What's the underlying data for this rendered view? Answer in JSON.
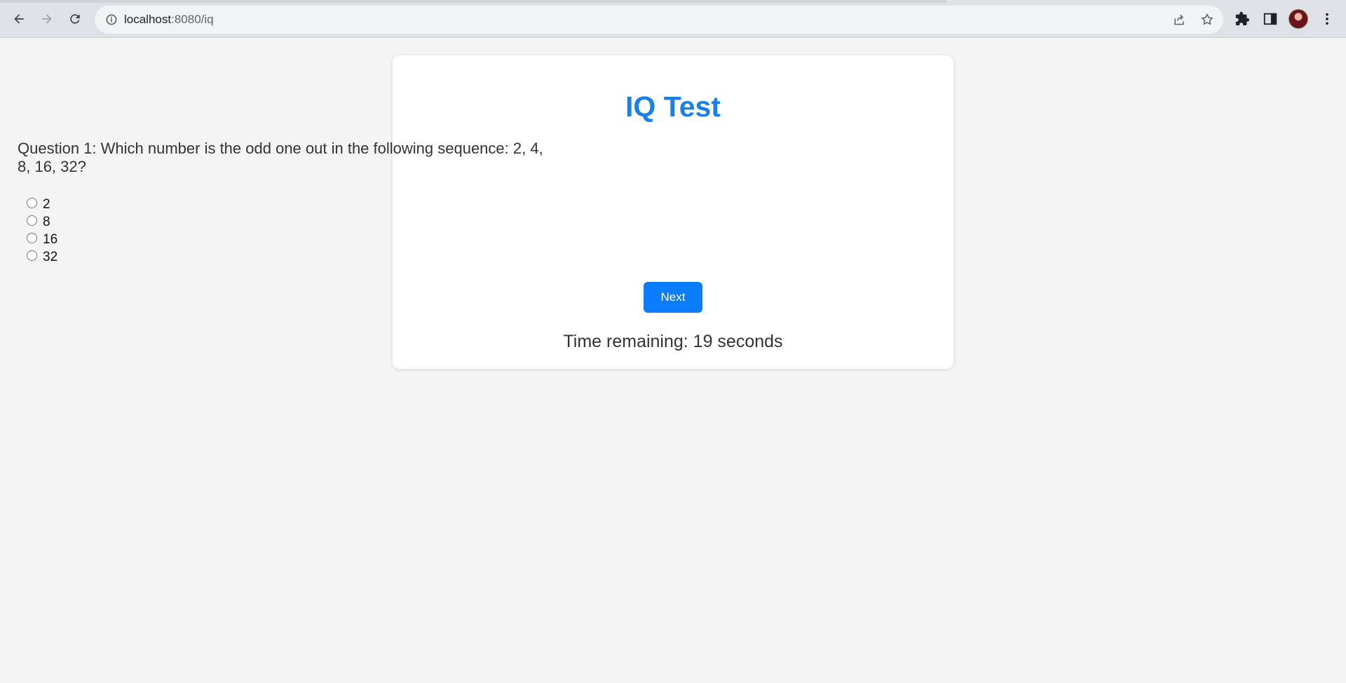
{
  "browser": {
    "url_host": "localhost",
    "url_rest": ":8080/iq",
    "icons": [
      "back-arrow-icon",
      "forward-arrow-icon",
      "reload-icon",
      "info-icon",
      "share-icon",
      "star-icon",
      "extensions-icon",
      "side-panel-icon",
      "profile-avatar",
      "more-vert-icon"
    ]
  },
  "page": {
    "title": "IQ Test",
    "question": "Question 1: Which number is the odd one out in the following sequence: 2, 4, 8, 16, 32?",
    "options": [
      {
        "label": "2"
      },
      {
        "label": "8"
      },
      {
        "label": "16"
      },
      {
        "label": "32"
      }
    ],
    "next_label": "Next",
    "timer_text": "Time remaining: 19 seconds"
  },
  "colors": {
    "accent": "#0a7cff",
    "title": "#1a7fe8",
    "background": "#f4f4f4"
  }
}
